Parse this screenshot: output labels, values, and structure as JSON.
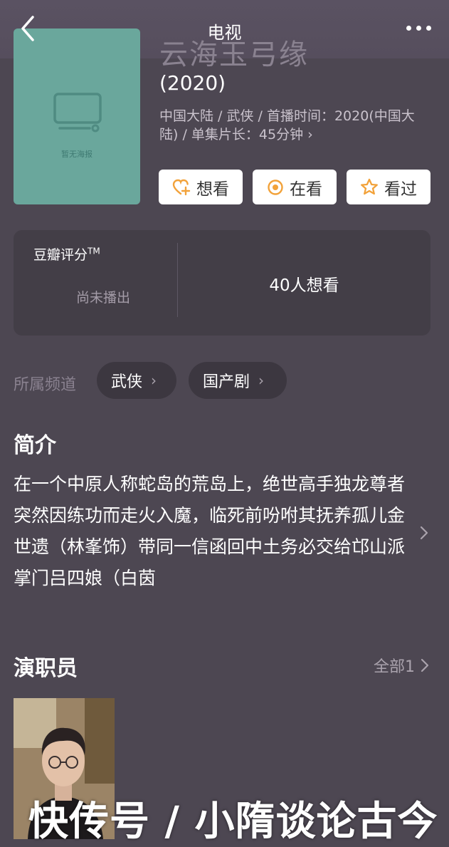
{
  "nav": {
    "title": "电视"
  },
  "poster": {
    "caption": "暂无海报"
  },
  "show": {
    "title": "云海玉弓缘",
    "year": "(2020)",
    "meta": "中国大陆 / 武侠 / 首播时间：2020(中国大陆) / 单集片长：45分钟 ›"
  },
  "actions": {
    "want": "想看",
    "watching": "在看",
    "watched": "看过"
  },
  "rating": {
    "label": "豆瓣评分",
    "tm": "TM",
    "status": "尚未播出",
    "want_count": "40人想看"
  },
  "channels": {
    "label": "所属频道",
    "items": [
      "武侠",
      "国产剧"
    ]
  },
  "synopsis": {
    "heading": "简介",
    "text": "在一个中原人称蛇岛的荒岛上，绝世高手独龙尊者突然因练功而走火入魔，临死前吩咐其抚养孤儿金世遗（林峯饰）带同一信函回中土务必交给邙山派掌门吕四娘（白茵"
  },
  "cast": {
    "heading": "演职员",
    "all": "全部1"
  },
  "watermark": "快传号 / 小隋谈论古今",
  "colors": {
    "background": "#4d4752",
    "card": "#433e47",
    "poster": "#6aa79c",
    "accent": "#f2a23a"
  }
}
